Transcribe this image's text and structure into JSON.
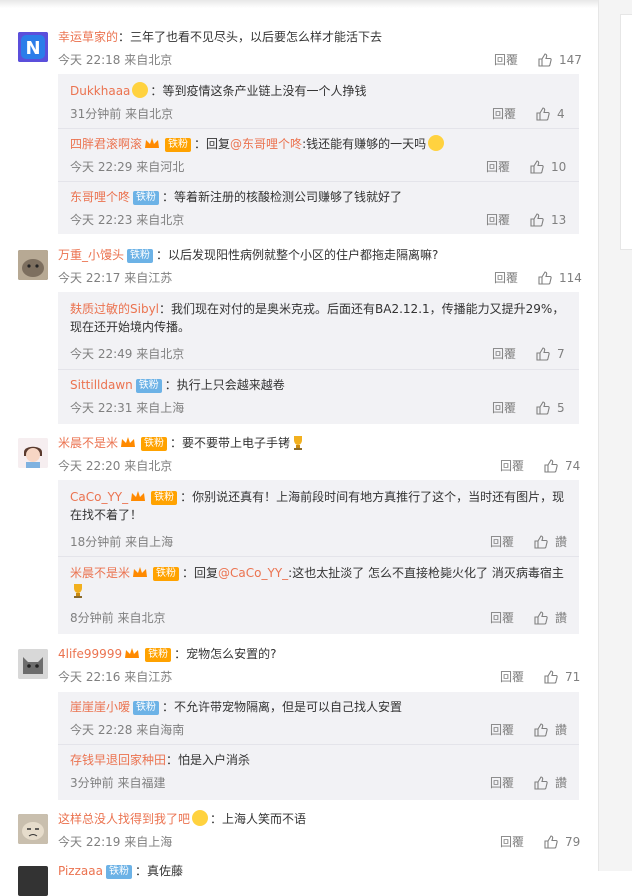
{
  "ui": {
    "reply_label": "回覆",
    "zan_label": "讚"
  },
  "comments": [
    {
      "user": "幸运草家的",
      "text": "三年了也看不见尽头，以后要怎么样才能活下去",
      "time": "今天 22:18 来自北京",
      "likes": "147",
      "replies": [
        {
          "user": "Dukkhaaa",
          "text": "等到疫情这条产业链上没有一个人挣钱",
          "time": "31分钟前 来自北京",
          "likes": "4"
        },
        {
          "user": "四胖君滚啊滚",
          "badge": "铁粉",
          "prefix": "回复",
          "mention": "@东哥哩个咚",
          "text": ":钱还能有赚够的一天吗",
          "time": "今天 22:29 来自河北",
          "likes": "10"
        },
        {
          "user": "东哥哩个咚",
          "badge": "铁粉",
          "text": "等着新注册的核酸检测公司赚够了钱就好了",
          "time": "今天 22:23 来自北京",
          "likes": "13"
        }
      ]
    },
    {
      "user": "万重_小馒头",
      "badge": "铁粉",
      "text": "以后发现阳性病例就整个小区的住户都拖走隔离嘛?",
      "time": "今天 22:17 来自江苏",
      "likes": "114",
      "replies": [
        {
          "user": "麸质过敏的Sibyl",
          "text": "我们现在对付的是奥米克戎。后面还有BA2.12.1，传播能力又提升29%，现在还开始境内传播。",
          "time": "今天 22:49 来自北京",
          "likes": "7"
        },
        {
          "user": "Sittilldawn",
          "badge": "铁粉",
          "text": "执行上只会越来越卷",
          "time": "今天 22:31 来自上海",
          "likes": "5"
        }
      ]
    },
    {
      "user": "米晨不是米",
      "badge": "铁粉",
      "text": "要不要带上电子手铐",
      "time": "今天 22:20 来自北京",
      "likes": "74",
      "replies": [
        {
          "user": "CaCo_YY_",
          "badge": "铁粉",
          "text": "你别说还真有！上海前段时间有地方真推行了这个，当时还有图片，现在找不着了！",
          "time": "18分钟前 来自上海",
          "likes": "讚"
        },
        {
          "user": "米晨不是米",
          "badge": "铁粉",
          "prefix": "回复",
          "mention": "@CaCo_YY_",
          "text": ":这也太扯淡了 怎么不直接枪毙火化了 消灭病毒宿主",
          "time": "8分钟前 来自北京",
          "likes": "讚"
        }
      ]
    },
    {
      "user": "4life99999",
      "badge": "铁粉",
      "text": "宠物怎么安置的?",
      "time": "今天 22:16 来自江苏",
      "likes": "71",
      "replies": [
        {
          "user": "崖崖崖小嗳",
          "badge": "铁粉",
          "text": "不允许带宠物隔离，但是可以自己找人安置",
          "time": "今天 22:28 来自海南",
          "likes": "讚"
        },
        {
          "user": "存钱早退回家种田",
          "text": "怕是入户消杀",
          "time": "3分钟前 来自福建",
          "likes": "讚"
        }
      ]
    },
    {
      "user": "这样总没人找得到我了吧",
      "text": "上海人笑而不语",
      "time": "今天 22:19 来自上海",
      "likes": "79",
      "replies": []
    },
    {
      "user": "Pizzaaa",
      "badge": "铁粉",
      "text": "真佐藤"
    }
  ],
  "colors": {
    "username": "#eb7350",
    "meta": "#808080",
    "reply_bg": "#f2f2f5",
    "badge_fan": "#6cb2e6",
    "badge_gold": "#ffa200"
  }
}
